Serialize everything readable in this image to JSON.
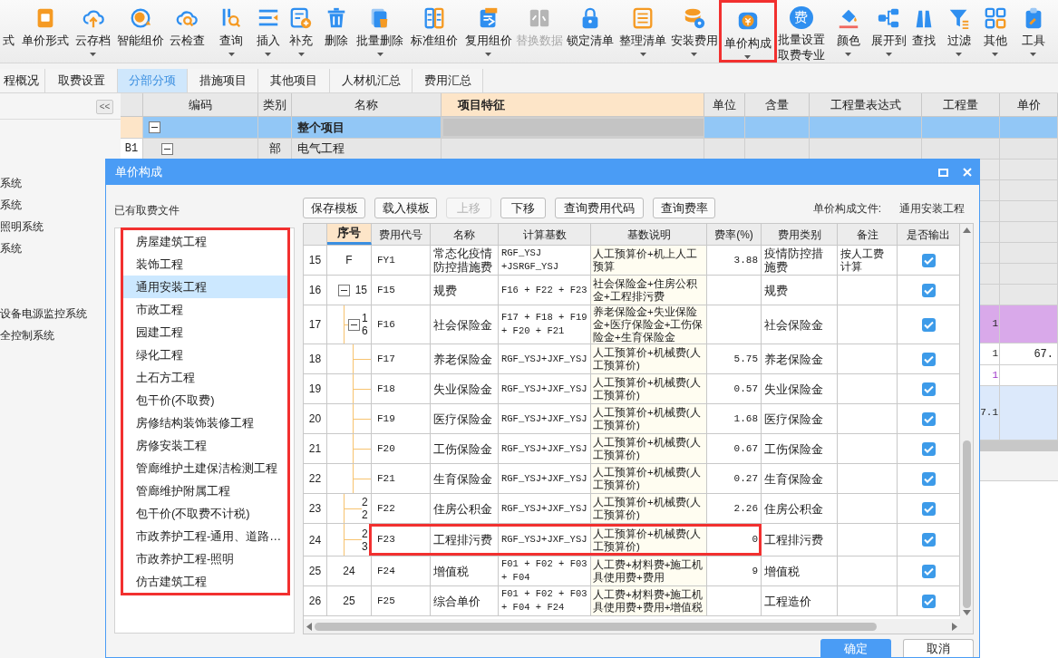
{
  "toolbar": [
    {
      "label": "式",
      "caret": false,
      "disabled": false,
      "highlighted": false
    },
    {
      "label": "单价形式",
      "caret": false,
      "disabled": false,
      "highlighted": false
    },
    {
      "label": "云存档",
      "caret": true,
      "disabled": false,
      "highlighted": false
    },
    {
      "label": "智能组价",
      "caret": false,
      "disabled": false,
      "highlighted": false
    },
    {
      "label": "云检查",
      "caret": false,
      "disabled": false,
      "highlighted": false
    },
    {
      "label": "查询",
      "caret": true,
      "disabled": false,
      "highlighted": false
    },
    {
      "label": "插入",
      "caret": true,
      "disabled": false,
      "highlighted": false
    },
    {
      "label": "补充",
      "caret": true,
      "disabled": false,
      "highlighted": false
    },
    {
      "label": "删除",
      "caret": false,
      "disabled": false,
      "highlighted": false
    },
    {
      "label": "批量删除",
      "caret": true,
      "disabled": false,
      "highlighted": false
    },
    {
      "label": "标准组价",
      "caret": false,
      "disabled": false,
      "highlighted": false
    },
    {
      "label": "复用组价",
      "caret": true,
      "disabled": false,
      "highlighted": false
    },
    {
      "label": "替换数据",
      "caret": false,
      "disabled": true,
      "highlighted": false
    },
    {
      "label": "锁定清单",
      "caret": false,
      "disabled": false,
      "highlighted": false
    },
    {
      "label": "整理清单",
      "caret": true,
      "disabled": false,
      "highlighted": false
    },
    {
      "label": "安装费用",
      "caret": true,
      "disabled": false,
      "highlighted": false
    },
    {
      "label": "单价构成",
      "caret": true,
      "disabled": false,
      "highlighted": true
    },
    {
      "label": "批量设置",
      "label_2": "取费专业",
      "badge": "费",
      "caret": false,
      "disabled": false,
      "highlighted": false
    },
    {
      "label": "颜色",
      "caret": true,
      "disabled": false,
      "highlighted": false
    },
    {
      "label": "展开到",
      "caret": true,
      "disabled": false,
      "highlighted": false
    },
    {
      "label": "查找",
      "caret": false,
      "disabled": false,
      "highlighted": false
    },
    {
      "label": "过滤",
      "caret": true,
      "disabled": false,
      "highlighted": false
    },
    {
      "label": "其他",
      "caret": true,
      "disabled": false,
      "highlighted": false
    },
    {
      "label": "工具",
      "caret": true,
      "disabled": false,
      "highlighted": false
    }
  ],
  "tabs": [
    {
      "label": "程概况",
      "selected": false
    },
    {
      "label": "取费设置",
      "selected": false
    },
    {
      "label": "分部分项",
      "selected": true
    },
    {
      "label": "措施项目",
      "selected": false
    },
    {
      "label": "其他项目",
      "selected": false
    },
    {
      "label": "人材机汇总",
      "selected": false
    },
    {
      "label": "费用汇总",
      "selected": false
    }
  ],
  "side_panel": {
    "collapse_button": "<<",
    "groups": [
      {
        "items": [
          "系统",
          "系统",
          "照明系统",
          "系统"
        ]
      },
      {
        "items": [
          "设备电源监控系统",
          "全控制系统"
        ]
      }
    ]
  },
  "grid": {
    "columns": [
      {
        "label": "编码",
        "selected": false
      },
      {
        "label": "类别",
        "selected": false
      },
      {
        "label": "名称",
        "selected": false
      },
      {
        "label": "项目特征",
        "selected": true
      },
      {
        "label": "单位",
        "selected": false
      },
      {
        "label": "含量",
        "selected": false
      },
      {
        "label": "工程量表达式",
        "selected": false
      },
      {
        "label": "工程量",
        "selected": false
      },
      {
        "label": "单价",
        "selected": false
      }
    ],
    "rows": [
      {
        "kind": "project",
        "expanded": true,
        "name": "整个项目",
        "selected": true
      },
      {
        "kind": "section",
        "number": "B1",
        "expanded": true,
        "type": "部",
        "name": "电气工程",
        "selected": false
      },
      {
        "kind": "measure",
        "quantity": "1",
        "selected": false
      },
      {
        "kind": "item",
        "quantity": "1",
        "price": "67.",
        "selected": false
      },
      {
        "kind": "sub",
        "quantity": "1",
        "selected": false
      },
      {
        "kind": "detail",
        "quantity": "7.1",
        "selected": false
      }
    ]
  },
  "dialog": {
    "title": "单价构成",
    "files_label": "已有取费文件",
    "files": {
      "highlighted": true,
      "items": [
        {
          "label": "房屋建筑工程",
          "selected": false
        },
        {
          "label": "装饰工程",
          "selected": false
        },
        {
          "label": "通用安装工程",
          "selected": true
        },
        {
          "label": "市政工程",
          "selected": false
        },
        {
          "label": "园建工程",
          "selected": false
        },
        {
          "label": "绿化工程",
          "selected": false
        },
        {
          "label": "土石方工程",
          "selected": false
        },
        {
          "label": "包干价(不取费)",
          "selected": false
        },
        {
          "label": "房修结构装饰装修工程",
          "selected": false
        },
        {
          "label": "房修安装工程",
          "selected": false
        },
        {
          "label": "管廊维护土建保洁检测工程",
          "selected": false
        },
        {
          "label": "管廊维护附属工程",
          "selected": false
        },
        {
          "label": "包干价(不取费不计税)",
          "selected": false
        },
        {
          "label": "市政养护工程-通用、道路…",
          "selected": false
        },
        {
          "label": "市政养护工程-照明",
          "selected": false
        },
        {
          "label": "仿古建筑工程",
          "selected": false
        }
      ]
    },
    "buttons": [
      {
        "label": "保存模板",
        "disabled": false
      },
      {
        "label": "载入模板",
        "disabled": false
      },
      {
        "label": "上移",
        "disabled": true
      },
      {
        "label": "下移",
        "disabled": false
      },
      {
        "label": "查询费用代码",
        "disabled": false
      },
      {
        "label": "查询费率",
        "disabled": false
      }
    ],
    "file_label": "单价构成文件:",
    "file_value": "通用安装工程",
    "table": {
      "columns": [
        {
          "label": "序号",
          "selected": true
        },
        {
          "label": "费用代号",
          "selected": false
        },
        {
          "label": "名称",
          "selected": false
        },
        {
          "label": "计算基数",
          "selected": false
        },
        {
          "label": "基数说明",
          "selected": false
        },
        {
          "label": "费率(%)",
          "selected": false
        },
        {
          "label": "费用类别",
          "selected": false
        },
        {
          "label": "备注",
          "selected": false
        },
        {
          "label": "是否输出",
          "selected": false
        }
      ],
      "rows": [
        {
          "no": "15",
          "seq": "F",
          "code": "FY1",
          "name": "常态化疫情防控措施费",
          "base": "RGF_YSJ+JSRGF_YSJ",
          "desc": "人工预算价+机上人工预算",
          "rate": "3.88",
          "category": "疫情防控措施费",
          "note": "按人工费计算",
          "output": true,
          "highlighted": false
        },
        {
          "no": "16",
          "seq": "15",
          "code": "F15",
          "name": "规费",
          "base": "F16 + F22 + F23",
          "desc": "社会保险金+住房公积金+工程排污费",
          "category": "规费",
          "output": true,
          "highlighted": false,
          "expanded": true,
          "children": [
            {
              "no": "17",
              "seq": "16",
              "code": "F16",
              "name": "社会保险金",
              "base": "F17 + F18 + F19 + F20 + F21",
              "desc": "养老保险金+失业保险金+医疗保险金+工伤保险金+生育保险金",
              "category": "社会保险金",
              "output": true,
              "highlighted": false,
              "expanded": true,
              "children": [
                {
                  "no": "18",
                  "code": "F17",
                  "name": "养老保险金",
                  "base": "RGF_YSJ+JXF_YSJ",
                  "desc": "人工预算价+机械费(人工预算价)",
                  "rate": "5.75",
                  "category": "养老保险金",
                  "output": true,
                  "highlighted": false
                },
                {
                  "no": "19",
                  "code": "F18",
                  "name": "失业保险金",
                  "base": "RGF_YSJ+JXF_YSJ",
                  "desc": "人工预算价+机械费(人工预算价)",
                  "rate": "0.57",
                  "category": "失业保险金",
                  "output": true,
                  "highlighted": false
                },
                {
                  "no": "20",
                  "code": "F19",
                  "name": "医疗保险金",
                  "base": "RGF_YSJ+JXF_YSJ",
                  "desc": "人工预算价+机械费(人工预算价)",
                  "rate": "1.68",
                  "category": "医疗保险金",
                  "output": true,
                  "highlighted": false
                },
                {
                  "no": "21",
                  "code": "F20",
                  "name": "工伤保险金",
                  "base": "RGF_YSJ+JXF_YSJ",
                  "desc": "人工预算价+机械费(人工预算价)",
                  "rate": "0.67",
                  "category": "工伤保险金",
                  "output": true,
                  "highlighted": false
                },
                {
                  "no": "22",
                  "code": "F21",
                  "name": "生育保险金",
                  "base": "RGF_YSJ+JXF_YSJ",
                  "desc": "人工预算价+机械费(人工预算价)",
                  "rate": "0.27",
                  "category": "生育保险金",
                  "output": true,
                  "highlighted": false
                }
              ]
            },
            {
              "no": "23",
              "seq": "22",
              "code": "F22",
              "name": "住房公积金",
              "base": "RGF_YSJ+JXF_YSJ",
              "desc": "人工预算价+机械费(人工预算价)",
              "rate": "2.26",
              "category": "住房公积金",
              "output": true,
              "highlighted": false
            },
            {
              "no": "24",
              "seq": "23",
              "code": "F23",
              "name": "工程排污费",
              "base": "RGF_YSJ+JXF_YSJ",
              "desc": "人工预算价+机械费(人工预算价)",
              "rate": "0",
              "category": "工程排污费",
              "output": true,
              "highlighted": true
            }
          ]
        },
        {
          "no": "25",
          "seq": "24",
          "code": "F24",
          "name": "增值税",
          "base": "F01 + F02 + F03 + F04",
          "desc": "人工费+材料费+施工机具使用费+费用",
          "rate": "9",
          "category": "增值税",
          "output": true,
          "highlighted": false
        },
        {
          "no": "26",
          "seq": "25",
          "code": "F25",
          "name": "综合单价",
          "base": "F01 + F02 + F03 + F04 + F24",
          "desc": "人工费+材料费+施工机具使用费+费用+增值税",
          "category": "工程造价",
          "output": true,
          "highlighted": false
        }
      ]
    },
    "footer_buttons": [
      {
        "label": "确定",
        "primary": true
      },
      {
        "label": "取消",
        "primary": false
      }
    ]
  }
}
